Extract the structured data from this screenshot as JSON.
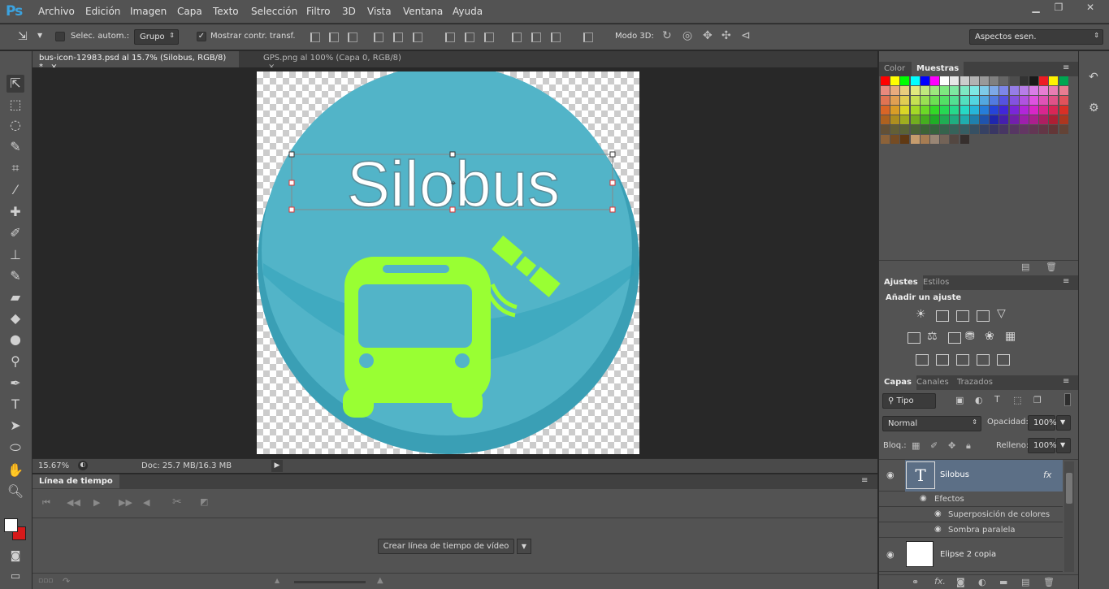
{
  "app": {
    "logo": "Ps"
  },
  "menu": [
    "Archivo",
    "Edición",
    "Imagen",
    "Capa",
    "Texto",
    "Selección",
    "Filtro",
    "3D",
    "Vista",
    "Ventana",
    "Ayuda"
  ],
  "window": {
    "minimize": "▁",
    "restore": "❐",
    "close": "✕"
  },
  "options": {
    "auto_select": "Selec. autom.:",
    "group_value": "Grupo",
    "show_transform": "Mostrar contr. transf.",
    "mode3d": "Modo 3D:",
    "workspace": "Aspectos esen."
  },
  "tabs": [
    {
      "label": "bus-icon-12983.psd al 15.7% (Silobus, RGB/8) *",
      "close": "×"
    },
    {
      "label": "GPS.png al 100% (Capa 0, RGB/8)",
      "close": "×"
    }
  ],
  "canvas": {
    "logo_text": "Silobus"
  },
  "status": {
    "zoom": "15.67%",
    "doc": "Doc: 25.7 MB/16.3 MB"
  },
  "timeline": {
    "title": "Línea de tiempo",
    "create_button": "Crear línea de tiempo de vídeo"
  },
  "swatches_panel": {
    "tabs": [
      "Color",
      "Muestras"
    ],
    "active": "Muestras"
  },
  "adjust_panel": {
    "tabs": [
      "Ajustes",
      "Estilos"
    ],
    "heading": "Añadir un ajuste"
  },
  "layers_panel": {
    "tabs": [
      "Capas",
      "Canales",
      "Trazados"
    ],
    "filter": "Tipo",
    "blend_mode": "Normal",
    "opacity_label": "Opacidad:",
    "opacity": "100%",
    "lock_label": "Bloq.:",
    "fill_label": "Relleno:",
    "fill": "100%",
    "layers": [
      {
        "name": "Silobus",
        "fx": "fx",
        "effects_label": "Efectos",
        "effects": [
          "Superposición de colores",
          "Sombra paralela"
        ]
      },
      {
        "name": "Elipse 2 copia"
      }
    ]
  },
  "colors": {
    "accent": "#3ba3e0",
    "circle": "#52b4c8",
    "bus": "#99ff33",
    "selected_layer": "#5c6f86"
  }
}
